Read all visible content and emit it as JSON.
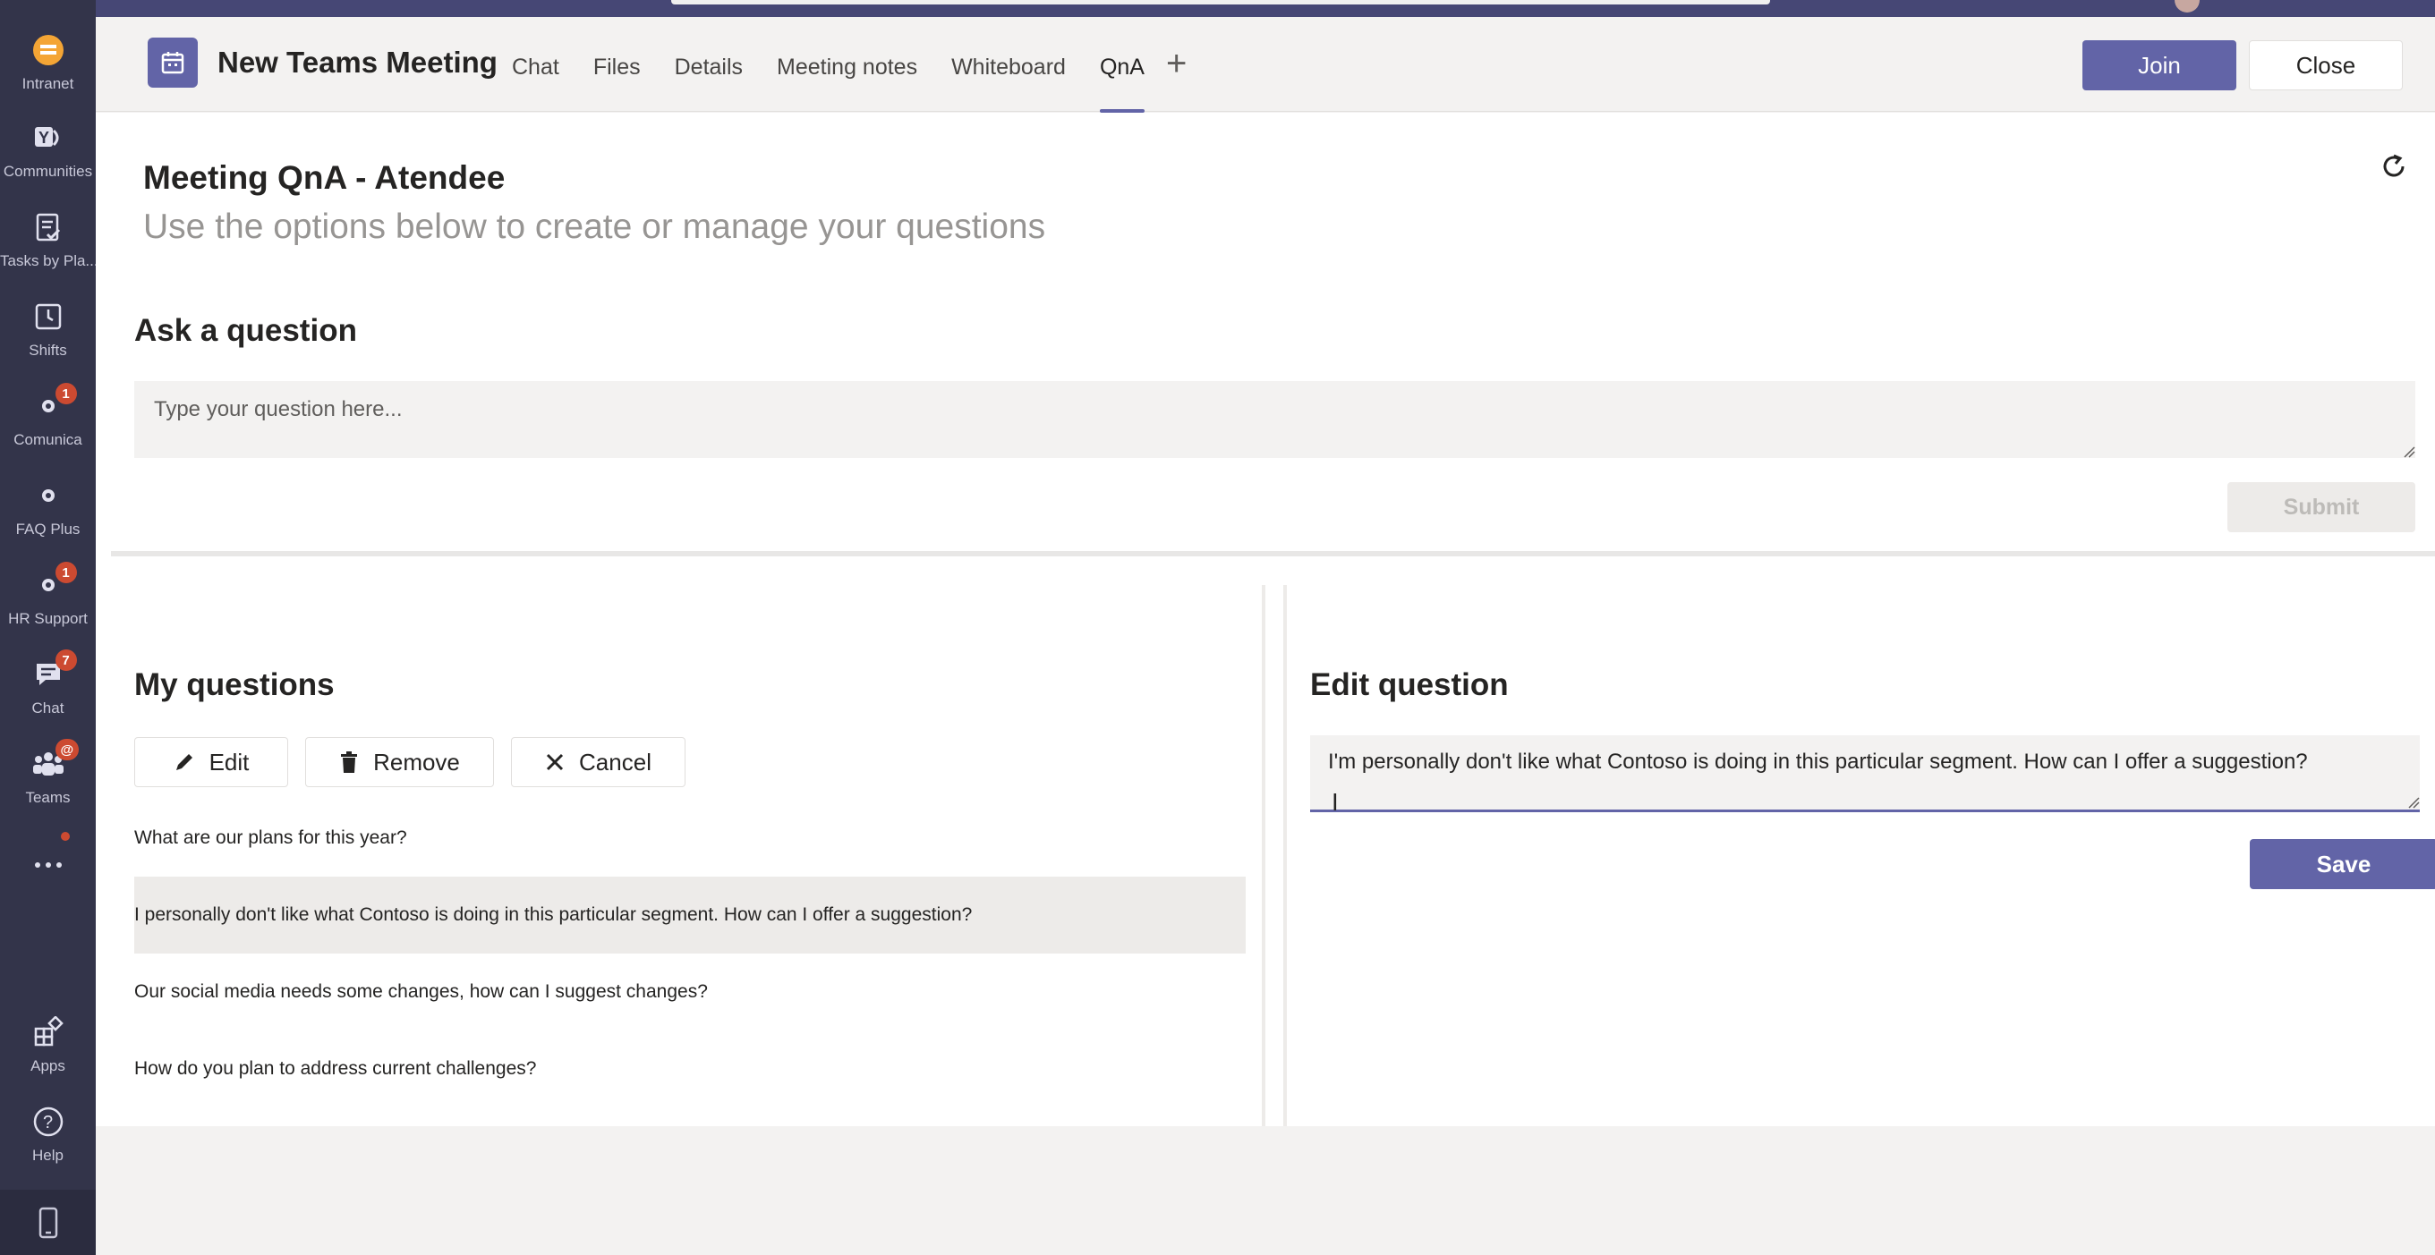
{
  "app": {
    "accent_color": "#6264a7",
    "rail_color": "#33344a"
  },
  "rail": {
    "items": [
      {
        "label": "Intranet",
        "icon": "intranet-icon",
        "badge": ""
      },
      {
        "label": "Communities",
        "icon": "yammer-icon",
        "badge": ""
      },
      {
        "label": "Tasks by Pla...",
        "icon": "tasks-icon",
        "badge": ""
      },
      {
        "label": "Shifts",
        "icon": "shifts-clock-icon",
        "badge": ""
      },
      {
        "label": "Comunica",
        "icon": "bot-icon",
        "badge": "1"
      },
      {
        "label": "FAQ Plus",
        "icon": "bot-icon",
        "badge": ""
      },
      {
        "label": "HR Support",
        "icon": "bot-icon",
        "badge": "1"
      },
      {
        "label": "Chat",
        "icon": "chat-icon",
        "badge": "7"
      },
      {
        "label": "Teams",
        "icon": "teams-icon",
        "badge": "@"
      },
      {
        "label": "",
        "icon": "more-dots-icon",
        "badge": ""
      },
      {
        "label": "Apps",
        "icon": "apps-icon",
        "badge": ""
      },
      {
        "label": "Help",
        "icon": "help-icon",
        "badge": ""
      }
    ]
  },
  "header": {
    "title": "New Teams Meeting",
    "tabs": [
      {
        "label": "Chat"
      },
      {
        "label": "Files"
      },
      {
        "label": "Details"
      },
      {
        "label": "Meeting notes"
      },
      {
        "label": "Whiteboard"
      },
      {
        "label": "QnA",
        "active": true
      }
    ],
    "join_label": "Join",
    "close_label": "Close"
  },
  "page": {
    "title": "Meeting QnA - Atendee",
    "subtitle": "Use the options below to create or manage your questions"
  },
  "ask": {
    "title": "Ask a question",
    "placeholder": "Type your question here...",
    "submit_label": "Submit"
  },
  "my_questions": {
    "title": "My questions",
    "edit_label": "Edit",
    "remove_label": "Remove",
    "cancel_label": "Cancel",
    "items": [
      {
        "text": "What are our plans for this year?"
      },
      {
        "text": "I personally don't like what Contoso is doing in this particular segment. How can I offer a suggestion?",
        "selected": true
      },
      {
        "text": "Our social media needs some changes, how can I suggest changes?"
      },
      {
        "text": "How do you plan to address current challenges?"
      }
    ]
  },
  "edit_question": {
    "title": "Edit question",
    "value": "I'm personally don't like what Contoso is doing in this particular segment. How can I offer a suggestion?",
    "save_label": "Save"
  }
}
